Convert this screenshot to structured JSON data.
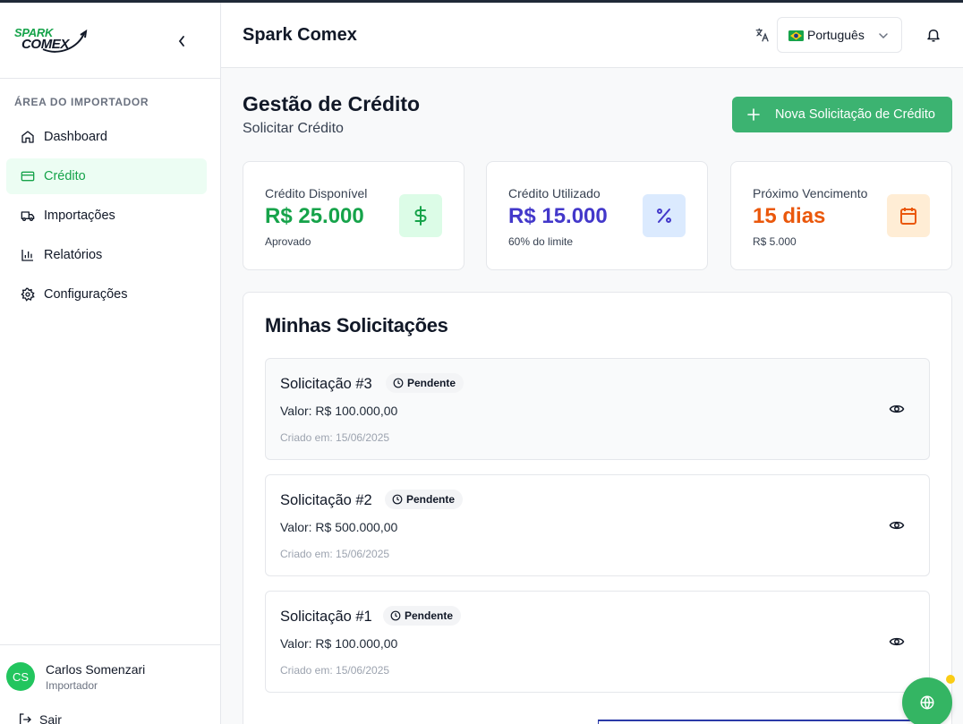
{
  "brand": {
    "logo_top": "SPARK",
    "logo_bottom": "COMEX"
  },
  "sidebar": {
    "section_label": "ÁREA DO IMPORTADOR",
    "items": [
      {
        "label": "Dashboard",
        "icon": "home-icon",
        "active": false
      },
      {
        "label": "Crédito",
        "icon": "credit-card-icon",
        "active": true
      },
      {
        "label": "Importações",
        "icon": "truck-icon",
        "active": false
      },
      {
        "label": "Relatórios",
        "icon": "bar-chart-icon",
        "active": false
      },
      {
        "label": "Configurações",
        "icon": "gear-icon",
        "active": false
      }
    ],
    "user": {
      "initials": "CS",
      "name": "Carlos Somenzari",
      "role": "Importador"
    },
    "logout_label": "Sair"
  },
  "header": {
    "title": "Spark Comex",
    "language": {
      "selected": "Português",
      "flag": "brazil-flag-icon"
    }
  },
  "main": {
    "title": "Gestão de Crédito",
    "subtitle": "Solicitar Crédito",
    "new_button_label": "Nova Solicitação de Crédito",
    "cards": [
      {
        "label": "Crédito Disponível",
        "value": "R$ 25.000",
        "sub": "Aprovado",
        "icon": "dollar-icon",
        "color": "#16a34a",
        "bg": "#dcfce7"
      },
      {
        "label": "Crédito Utilizado",
        "value": "R$ 15.000",
        "sub": "60% do limite",
        "icon": "percent-icon",
        "color": "#4338ca",
        "bg": "#dbeafe"
      },
      {
        "label": "Próximo Vencimento",
        "value": "15 dias",
        "sub": "R$ 5.000",
        "icon": "calendar-icon",
        "color": "#ea580c",
        "bg": "#ffedd5"
      }
    ],
    "requests_title": "Minhas Solicitações",
    "requests": [
      {
        "title": "Solicitação #3",
        "status": "Pendente",
        "value": "Valor: R$ 100.000,00",
        "created": "Criado em: 15/06/2025"
      },
      {
        "title": "Solicitação #2",
        "status": "Pendente",
        "value": "Valor: R$ 500.000,00",
        "created": "Criado em: 15/06/2025"
      },
      {
        "title": "Solicitação #1",
        "status": "Pendente",
        "value": "Valor: R$ 100.000,00",
        "created": "Criado em: 15/06/2025"
      }
    ]
  },
  "colors": {
    "accent": "#16a34a",
    "button": "#3cb371",
    "fab": "#34b563",
    "notification_dot": "#facc15"
  }
}
